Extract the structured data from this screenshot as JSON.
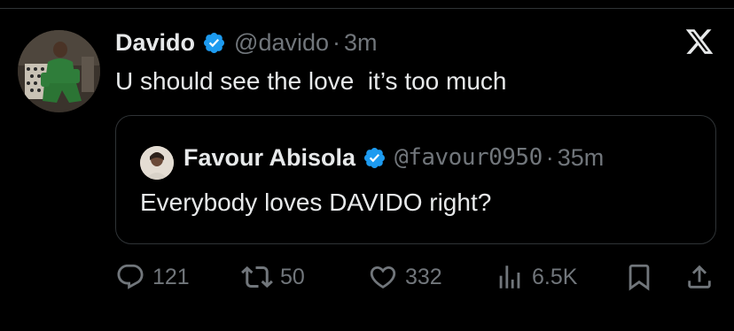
{
  "tweet": {
    "author_name": "Davido",
    "author_handle": "@davido",
    "separator": "·",
    "time": "3m",
    "text": "U should see the love  it’s too much"
  },
  "quoted": {
    "author_name": "Favour Abisola",
    "author_handle": "@favour0950",
    "separator": "·",
    "time": "35m",
    "text": "Everybody loves DAVIDO right?"
  },
  "actions": {
    "replies": "121",
    "reposts": "50",
    "likes": "332",
    "views": "6.5K"
  },
  "icons": {
    "verified": "verified-badge-icon",
    "x_logo": "x-logo-icon",
    "reply": "reply-icon",
    "repost": "repost-icon",
    "like": "heart-icon",
    "views": "views-icon",
    "bookmark": "bookmark-icon",
    "share": "share-icon"
  },
  "colors": {
    "background": "#000000",
    "text": "#e7e9ea",
    "secondary": "#71767b",
    "verified": "#1d9bf0",
    "border": "#2f3336"
  }
}
